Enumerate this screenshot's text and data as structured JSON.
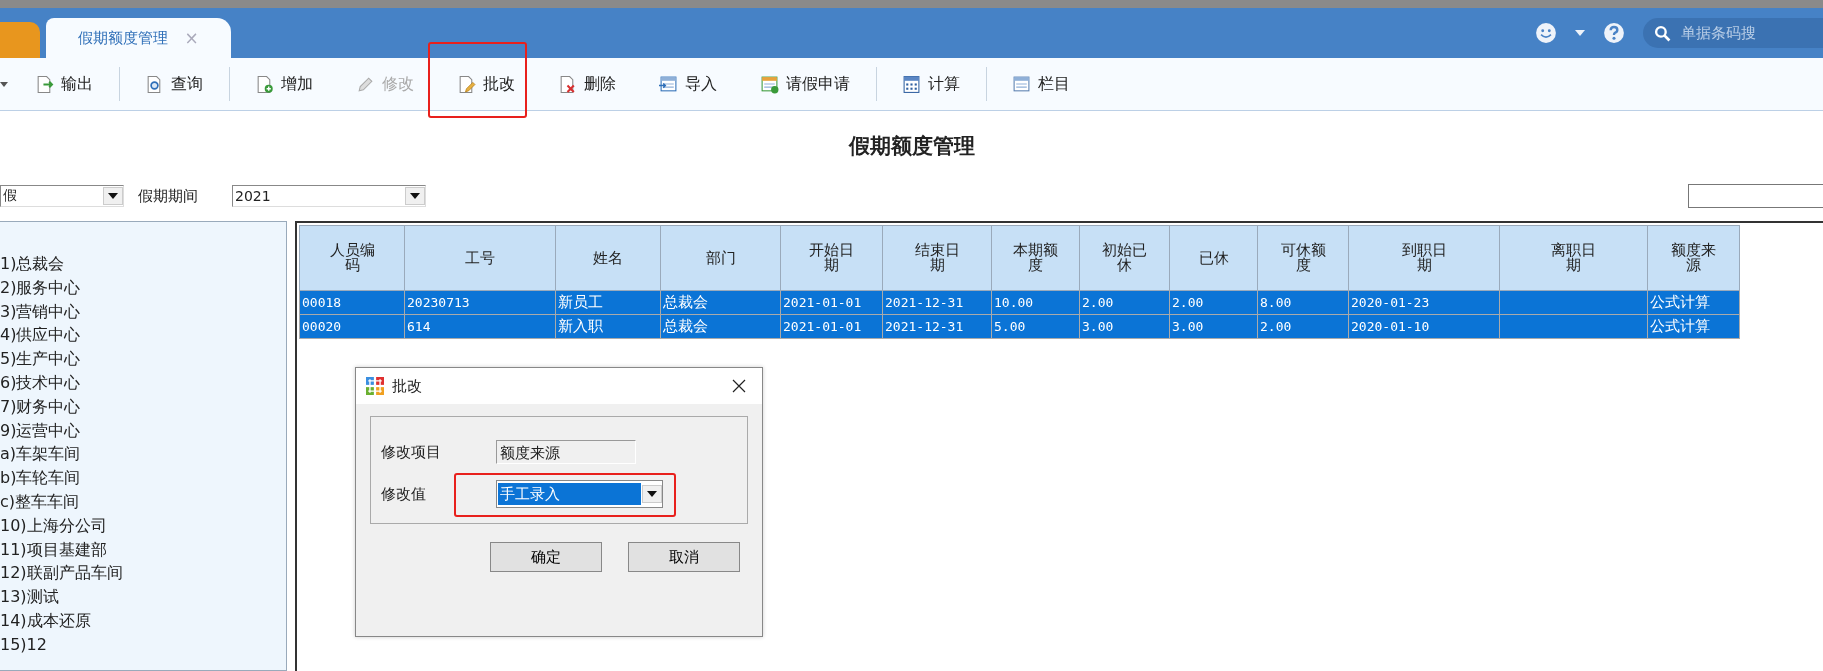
{
  "header": {
    "tab": {
      "label": "假期额度管理",
      "close": "×"
    },
    "search": {
      "placeholder": "单据条码搜"
    }
  },
  "toolbar": {
    "groups": [
      [
        {
          "label": "输出",
          "kind": "export",
          "disabled": false
        }
      ],
      [
        {
          "label": "查询",
          "kind": "query",
          "disabled": false
        }
      ],
      [
        {
          "label": "增加",
          "kind": "add",
          "disabled": false
        },
        {
          "label": "修改",
          "kind": "edit",
          "disabled": true
        },
        {
          "label": "批改",
          "kind": "batch",
          "disabled": false
        },
        {
          "label": "删除",
          "kind": "delete",
          "disabled": false
        },
        {
          "label": "导入",
          "kind": "import",
          "disabled": false
        },
        {
          "label": "请假申请",
          "kind": "leave",
          "disabled": false
        }
      ],
      [
        {
          "label": "计算",
          "kind": "calc",
          "disabled": false
        }
      ],
      [
        {
          "label": "栏目",
          "kind": "columns",
          "disabled": false
        }
      ]
    ]
  },
  "page_title": "假期额度管理",
  "filters": {
    "type_combo": {
      "value": "假"
    },
    "period_label": "假期期间",
    "period_combo": {
      "value": "2021"
    }
  },
  "tree": {
    "items": [
      "1)总裁会",
      "2)服务中心",
      "3)营销中心",
      "4)供应中心",
      "5)生产中心",
      "6)技术中心",
      "7)财务中心",
      "9)运营中心",
      "a)车架车间",
      "b)车轮车间",
      "c)整车车间",
      "10)上海分公司",
      "11)项目基建部",
      "12)联副产品车间",
      "13)测试",
      "14)成本还原",
      "15)12"
    ]
  },
  "table": {
    "columns": [
      "人员编码",
      "工号",
      "姓名",
      "部门",
      "开始日期",
      "结束日期",
      "本期额度",
      "初始已休",
      "已休",
      "可休额度",
      "到职日期",
      "离职日期",
      "额度来源"
    ],
    "rows": [
      {
        "selected": true,
        "cells": [
          "00018",
          "20230713",
          "新员工",
          "总裁会",
          "2021-01-01",
          "2021-12-31",
          "10.00",
          "2.00",
          "2.00",
          "8.00",
          "2020-01-23",
          "",
          "公式计算"
        ]
      },
      {
        "selected": true,
        "cells": [
          "00020",
          "614",
          "新入职",
          "总裁会",
          "2021-01-01",
          "2021-12-31",
          "5.00",
          "3.00",
          "3.00",
          "2.00",
          "2020-01-10",
          "",
          "公式计算"
        ]
      }
    ]
  },
  "dialog": {
    "title": "批改",
    "fields": [
      {
        "label": "修改项目",
        "kind": "readonly",
        "value": "额度来源"
      },
      {
        "label": "修改值",
        "kind": "combo",
        "value": "手工录入"
      }
    ],
    "buttons": [
      "确定",
      "取消"
    ]
  }
}
